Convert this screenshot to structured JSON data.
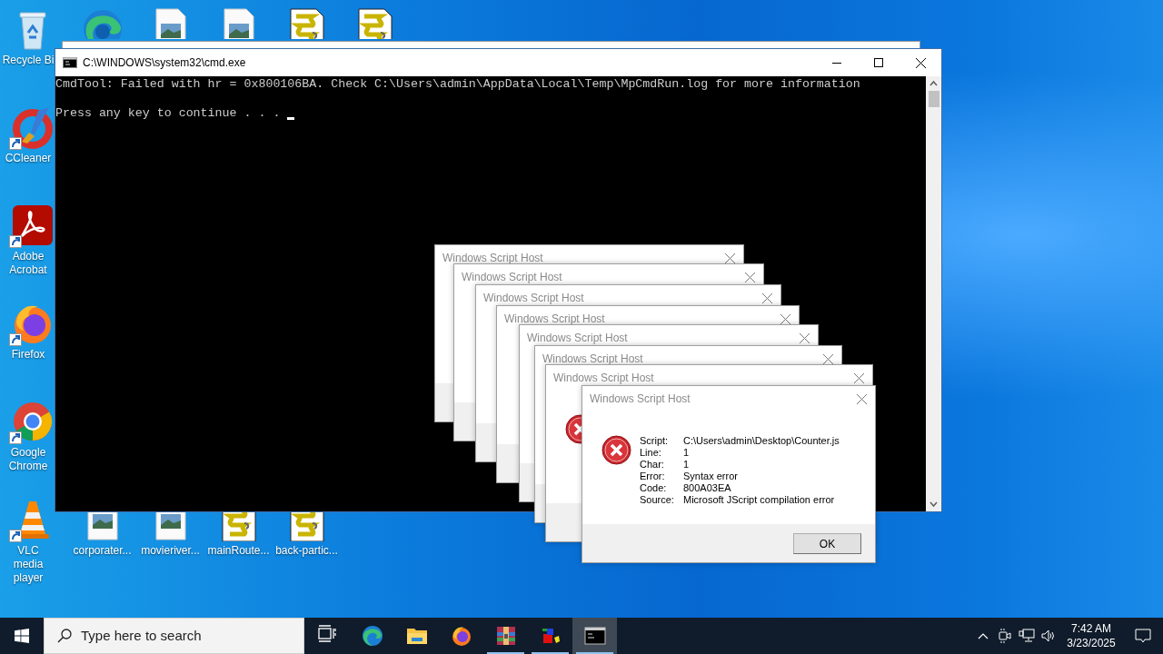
{
  "desktop_icons": [
    {
      "kind": "recycle_bin",
      "label": "Recycle Bi",
      "shortcut": false
    },
    {
      "kind": "edge",
      "shortcut": false
    },
    {
      "kind": "image",
      "shortcut": false
    },
    {
      "kind": "image",
      "shortcut": false
    },
    {
      "kind": "script",
      "shortcut": false
    },
    {
      "kind": "script",
      "shortcut": false
    },
    {
      "kind": "ccleaner",
      "label": "CCleaner",
      "shortcut": true
    },
    {
      "kind": "acrobat",
      "label": "Adobe Acrobat",
      "shortcut": true
    },
    {
      "kind": "firefox",
      "label": "Firefox",
      "shortcut": true
    },
    {
      "kind": "chrome",
      "label": "Google Chrome",
      "shortcut": true
    },
    {
      "kind": "vlc",
      "label": "VLC media player",
      "shortcut": true
    },
    {
      "kind": "image",
      "label": "corporater...",
      "shortcut": false
    },
    {
      "kind": "image",
      "label": "movieriver...",
      "shortcut": false
    },
    {
      "kind": "script",
      "label": "mainRoute...",
      "shortcut": false
    },
    {
      "kind": "script",
      "label": "back-partic...",
      "shortcut": false
    }
  ],
  "cmd_window": {
    "title": "C:\\WINDOWS\\system32\\cmd.exe",
    "cursor": true,
    "lines": [
      {
        "text": "CmdTool: Failed with hr = 0x800106BA. Check C:\\Users\\admin\\AppData\\Local\\Temp\\MpCmdRun.log for more information"
      },
      {
        "text": "Press any key to continue . . . "
      }
    ]
  },
  "dialogs": [
    {
      "title": "Windows Script Host",
      "kind": "plain"
    },
    {
      "title": "Windows Script Host",
      "kind": "plain"
    },
    {
      "title": "Windows Script Host",
      "kind": "plain"
    },
    {
      "title": "Windows Script Host",
      "kind": "plain"
    },
    {
      "title": "Windows Script Host",
      "kind": "plain"
    },
    {
      "title": "Windows Script Host",
      "kind": "plain"
    },
    {
      "title": "Windows Script Host",
      "kind": "error"
    },
    {
      "title": "Windows Script Host",
      "kind": "error",
      "fields": [
        {
          "label": "Script:",
          "value": "C:\\Users\\admin\\Desktop\\Counter.js"
        },
        {
          "label": "Line:",
          "value": "1"
        },
        {
          "label": "Char:",
          "value": "1"
        },
        {
          "label": "Error:",
          "value": "Syntax error"
        },
        {
          "label": "Code:",
          "value": "800A03EA"
        },
        {
          "label": "Source:",
          "value": "Microsoft JScript compilation error"
        }
      ],
      "button": "OK"
    }
  ],
  "taskbar": {
    "search_placeholder": "Type here to search",
    "apps": [
      {
        "kind": "task_view",
        "running": false,
        "active": false
      },
      {
        "kind": "edge",
        "running": false,
        "active": false
      },
      {
        "kind": "explorer",
        "running": false,
        "active": false
      },
      {
        "kind": "firefox",
        "running": false,
        "active": false
      },
      {
        "kind": "winrar",
        "running": true,
        "active": false
      },
      {
        "kind": "app",
        "running": true,
        "active": false
      },
      {
        "kind": "cmd",
        "running": true,
        "active": true
      }
    ],
    "time": "7:42 AM",
    "date": "3/23/2025"
  }
}
